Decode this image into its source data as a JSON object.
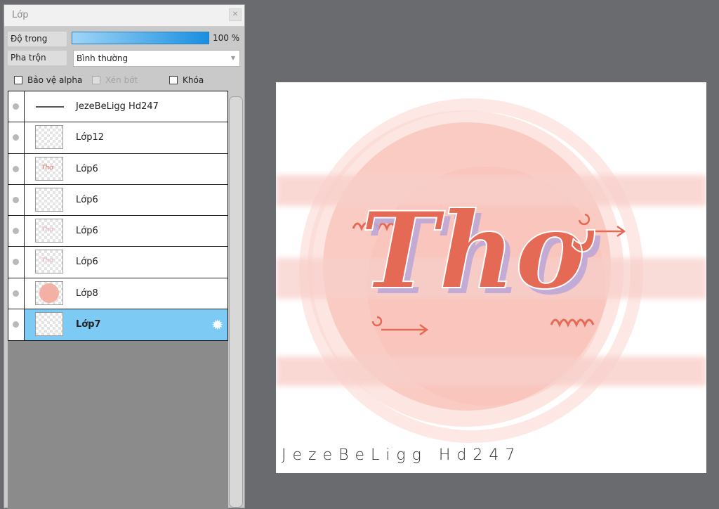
{
  "panel": {
    "title": "Lớp",
    "close_icon": "close-icon",
    "opacity_label": "Độ trong",
    "opacity_value": "100 %",
    "opacity_fraction": 1.0,
    "blend_label": "Pha trộn",
    "blend_value": "Bình thường",
    "protect_alpha": "Bảo vệ alpha",
    "clipping": "Xén bớt",
    "lock": "Khóa",
    "layers": [
      {
        "name": "JezeBeLigg  Hd247",
        "thumb": "line",
        "selected": false
      },
      {
        "name": "Lớp12",
        "thumb": "empty",
        "selected": false
      },
      {
        "name": "Lớp6",
        "thumb": "text",
        "selected": false
      },
      {
        "name": "Lớp6",
        "thumb": "empty",
        "selected": false
      },
      {
        "name": "Lớp6",
        "thumb": "text-faint",
        "selected": false
      },
      {
        "name": "Lớp6",
        "thumb": "text-faint",
        "selected": false
      },
      {
        "name": "Lớp8",
        "thumb": "circle",
        "selected": false
      },
      {
        "name": "Lớp7",
        "thumb": "empty",
        "selected": true
      }
    ]
  },
  "canvas": {
    "lettering": "Thơ",
    "signature": "JezeBeLigg  Hd247",
    "accent": "#e56a55",
    "stripe_color": "#f8cfca",
    "circle_color": "#f9c6bd"
  },
  "colors": {
    "selected_row": "#7dcbf4",
    "workspace": "#6a6b6f"
  }
}
